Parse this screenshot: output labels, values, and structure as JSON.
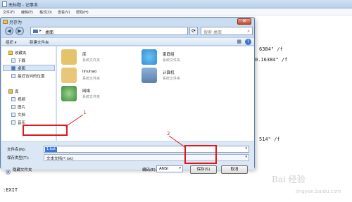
{
  "notepad": {
    "title": "无标题 - 记事本",
    "menus": [
      "文件(F)",
      "编辑(E)",
      "格式(O)",
      "查看(V)",
      "帮助(H)"
    ],
    "text_lines": [
      {
        "text": "6384\" /f",
        "class": "l1"
      },
      {
        "text": "0.16384\" /f",
        "class": "l2"
      },
      {
        "text": "514\" /f",
        "class": "l3"
      },
      {
        "text": ":EXIT",
        "class": "l4"
      }
    ]
  },
  "dialog": {
    "title": "另存为",
    "close_label": "✕",
    "address_path": "桌面",
    "search_placeholder": "搜索 桌面",
    "toolbar": {
      "organize": "组织 ▾",
      "new_folder": "新建文件夹"
    },
    "nav": {
      "favorites": "收藏夹",
      "downloads": "下载",
      "desktop": "桌面",
      "recent": "最近访问的位置",
      "libraries": "库",
      "videos": "视频",
      "pictures": "图片",
      "documents": "文档",
      "music": "音乐"
    },
    "items": [
      {
        "name": "库",
        "sub": "系统文件夹",
        "icon": "library-icon",
        "color": "#e3c46a"
      },
      {
        "name": "家庭组",
        "sub": "系统文件夹",
        "icon": "homegroup-icon",
        "color": "#2f8fd8"
      },
      {
        "name": "linuhao",
        "sub": "系统文件夹",
        "icon": "user-folder-icon",
        "color": "#e8c77a"
      },
      {
        "name": "计算机",
        "sub": "系统文件夹",
        "icon": "computer-icon",
        "color": "#5b7fae"
      },
      {
        "name": "网络",
        "sub": "系统文件夹",
        "icon": "network-icon",
        "color": "#3c8c3a"
      }
    ],
    "filename_label": "文件名(N):",
    "filename_value": "1.bat",
    "filetype_label": "保存类型(T):",
    "filetype_value": "文本文档(*.txt)",
    "hide_folders": "隐藏文件夹",
    "encoding_label": "编码(E):",
    "encoding_value": "ANSI",
    "save_button": "保存(S)",
    "cancel_button": "取消"
  },
  "annotations": {
    "one": "1",
    "two": "2"
  },
  "watermark": {
    "text": "Bai 经验",
    "sub": "jingyan.baidu.com"
  },
  "colors": {
    "annotation_red": "#e0161c",
    "selection_blue": "#3b78d8"
  }
}
